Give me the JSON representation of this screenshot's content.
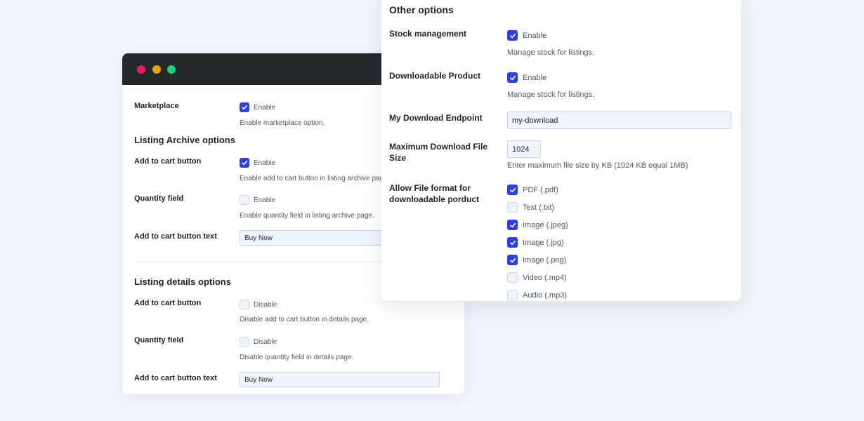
{
  "back_window": {
    "marketplace": {
      "label": "Marketplace",
      "check_label": "Enable",
      "checked": true,
      "desc": "Enable marketplace option."
    },
    "archive_section": "Listing Archive options",
    "archive_add_to_cart": {
      "label": "Add to cart button",
      "check_label": "Enable",
      "checked": true,
      "desc": "Enable add to cart button in listing archive page."
    },
    "archive_quantity": {
      "label": "Quantity field",
      "check_label": "Enable",
      "checked": false,
      "desc": "Enable quantity field in listing archive page."
    },
    "archive_button_text": {
      "label": "Add to cart button text",
      "value": "Buy Now"
    },
    "details_section": "Listing details options",
    "details_add_to_cart": {
      "label": "Add to cart button",
      "check_label": "Disable",
      "checked": false,
      "desc": "Disable add to cart button in details page."
    },
    "details_quantity": {
      "label": "Quantity field",
      "check_label": "Disable",
      "checked": false,
      "desc": "Disable quantity field in details page."
    },
    "details_button_text": {
      "label": "Add to cart button text",
      "value": "Buy Now"
    }
  },
  "front_window": {
    "section": "Other options",
    "stock": {
      "label": "Stock management",
      "check_label": "Enable",
      "checked": true,
      "desc": "Manage stock for listings."
    },
    "downloadable": {
      "label": "Downloadable Product",
      "check_label": "Enable",
      "checked": true,
      "desc": "Manage stock for listings."
    },
    "endpoint": {
      "label": "My Download Endpoint",
      "value": "my-download"
    },
    "max_size": {
      "label": "Maximum Download File Size",
      "value": "1024",
      "desc": "Enter maximum file size by KB (1024 KB equal 1MB)"
    },
    "formats": {
      "label": "Allow File format for downloadable porduct",
      "items": [
        {
          "label": "PDF (.pdf)",
          "checked": true
        },
        {
          "label": "Text (.txt)",
          "checked": false
        },
        {
          "label": "Image (.jpeg)",
          "checked": true
        },
        {
          "label": "Image (.jpg)",
          "checked": true
        },
        {
          "label": "Image (.png)",
          "checked": true
        },
        {
          "label": "Video (.mp4)",
          "checked": false
        },
        {
          "label": "Audio (.mp3)",
          "checked": false
        }
      ]
    }
  },
  "colors": {
    "accent": "#2f3ee0",
    "titlebar": "#23282d",
    "background": "#f1f6fd"
  }
}
